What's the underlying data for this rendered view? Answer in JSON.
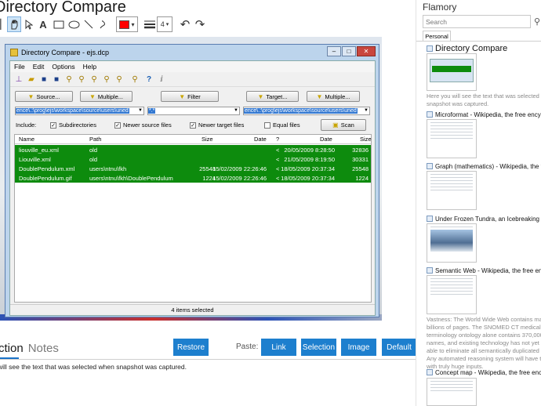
{
  "app": {
    "title": "Directory Compare"
  },
  "toolbar": {
    "text_tool": "A",
    "stroke_size": "4",
    "stroke_arrow": "▾"
  },
  "colors": {
    "accent": "#1d7fce",
    "selected_row": "#0d8b0d",
    "color_swatch": "#ff0000"
  },
  "window": {
    "title": "Directory Compare - ejs.dcp",
    "controls": [
      "–",
      "□",
      "✕"
    ],
    "menu": [
      "File",
      "Edit",
      "Options",
      "Help"
    ],
    "buttons": {
      "source": "Source...",
      "multiple_left": "Multiple...",
      "filter": "Filter",
      "target": "Target...",
      "multiple_right": "Multiple...",
      "scan": "Scan"
    },
    "combos": {
      "source_path": "ence\\.:\\prog\\ejs\\workspace\\source\\users\\uned",
      "filter_value": "*.*",
      "target_path": "ence\\.:\\prog\\ejs\\workspace\\source\\users\\uned"
    },
    "include_label": "Include:",
    "options": {
      "subdirectories": "Subdirectories",
      "newer_source": "Newer source files",
      "newer_target": "Newer target files",
      "equal": "Equal files"
    },
    "columns": [
      "Name",
      "Path",
      "Size",
      "Date",
      "?",
      "Date",
      "Size"
    ],
    "rows": [
      {
        "name": "liouville_eu.xml",
        "path": "old",
        "size_l": "",
        "date_l": "",
        "cmp": "<",
        "date_r": "20/05/2009 8:28:50",
        "size_r": "32836"
      },
      {
        "name": "Liouville.xml",
        "path": "old",
        "size_l": "",
        "date_l": "",
        "cmp": "<",
        "date_r": "21/05/2009 8:19:50",
        "size_r": "30331"
      },
      {
        "name": "DoublePendulum.xml",
        "path": "users\\ntnu\\fkh",
        "size_l": "25548",
        "date_l": "15/02/2009 22:26:46",
        "cmp": "<",
        "date_r": "18/05/2009 20:37:34",
        "size_r": "25548"
      },
      {
        "name": "DoublePendulum.gif",
        "path": "users\\ntnu\\fkh\\DoublePendulum",
        "size_l": "1224",
        "date_l": "15/02/2009 22:26:46",
        "cmp": "<",
        "date_r": "18/05/2009 20:37:34",
        "size_r": "1224"
      }
    ],
    "status": "4 items selected"
  },
  "bottom": {
    "tab_active": "ction",
    "tab_notes": "Notes",
    "restore": "Restore",
    "paste_label": "Paste:",
    "paste_buttons": [
      "Link",
      "Selection",
      "Image",
      "Default"
    ],
    "description": "will see the text that was selected when snapshot was captured."
  },
  "right_panel": {
    "title": "Flamory",
    "search_placeholder": "Search",
    "tab": "Personal",
    "items": [
      {
        "title": "Directory Compare",
        "desc": [
          "Here you will see the text that was selected when",
          "snapshot was captured."
        ]
      },
      {
        "title": "Microformat - Wikipedia, the free encyclopedia",
        "desc": []
      },
      {
        "title": "Graph (mathematics) - Wikipedia, the free encyclopedia",
        "desc": []
      },
      {
        "title": "Under Frozen Tundra, an Icebreaking Ship",
        "desc": []
      },
      {
        "title": "Semantic Web - Wikipedia, the free encyclopedia",
        "desc": [
          "Vastness: The World Wide Web contains many",
          "billions of pages. The SNOMED CT medical",
          "terminology ontology alone contains 370,000 class",
          "names, and existing technology has not yet been",
          "able to eliminate all semantically duplicated terms.",
          "Any automated reasoning system will have to deal",
          "with truly huge inputs."
        ]
      },
      {
        "title": "Concept map - Wikipedia, the free encyclopedia",
        "desc": []
      }
    ]
  }
}
